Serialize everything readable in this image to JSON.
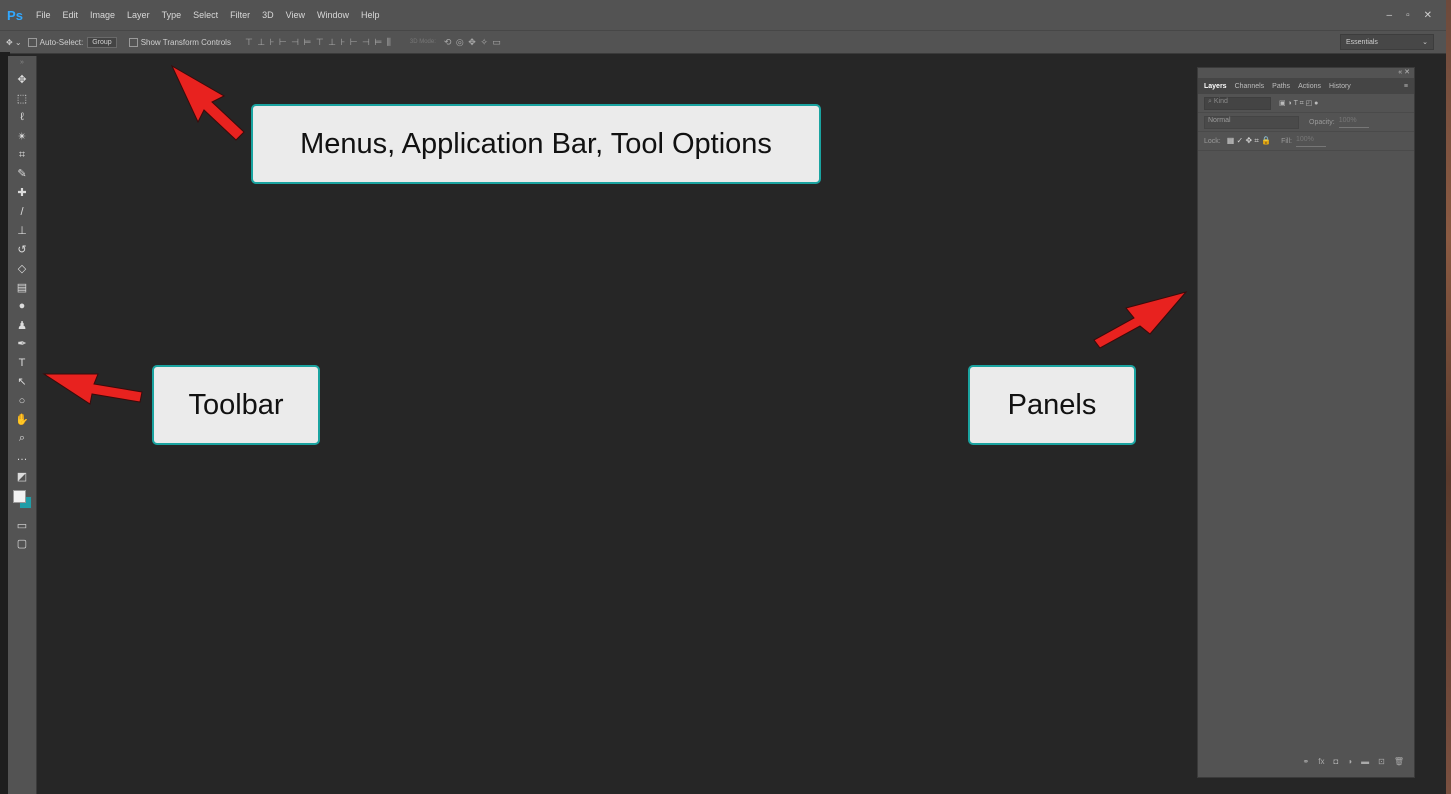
{
  "app": {
    "logo": "Ps",
    "menus": [
      "File",
      "Edit",
      "Image",
      "Layer",
      "Type",
      "Select",
      "Filter",
      "3D",
      "View",
      "Window",
      "Help"
    ],
    "window_controls": [
      "–",
      "▫",
      "✕"
    ]
  },
  "options_bar": {
    "auto_select_label": "Auto-Select:",
    "auto_select_value": "Group",
    "show_transform_label": "Show Transform Controls",
    "align_icons": "⊤ ⊥ ⊦ ⊢ ⊣ ⊨ ⊤ ⊥ ⊦ ⊢ ⊣ ⊨ ⫼",
    "mode_3d_label": "3D Mode:",
    "mode_3d_icons": "⟲ ◎ ✥ ✧ ▭",
    "workspace": "Essentials",
    "workspace_chevron": "⌄"
  },
  "toolbar": {
    "grip": "»",
    "tools": [
      {
        "name": "move-tool",
        "glyph": "✥"
      },
      {
        "name": "marquee-tool",
        "glyph": "⬚"
      },
      {
        "name": "lasso-tool",
        "glyph": "ℓ"
      },
      {
        "name": "magic-wand-tool",
        "glyph": "✴"
      },
      {
        "name": "crop-tool",
        "glyph": "⌗"
      },
      {
        "name": "eyedropper-tool",
        "glyph": "✎"
      },
      {
        "name": "healing-brush-tool",
        "glyph": "✚"
      },
      {
        "name": "brush-tool",
        "glyph": "/"
      },
      {
        "name": "clone-stamp-tool",
        "glyph": "⊥"
      },
      {
        "name": "history-brush-tool",
        "glyph": "↺"
      },
      {
        "name": "eraser-tool",
        "glyph": "◇"
      },
      {
        "name": "gradient-tool",
        "glyph": "▤"
      },
      {
        "name": "blur-tool",
        "glyph": "●"
      },
      {
        "name": "dodge-tool",
        "glyph": "♟"
      },
      {
        "name": "pen-tool",
        "glyph": "✒"
      },
      {
        "name": "type-tool",
        "glyph": "T"
      },
      {
        "name": "path-selection-tool",
        "glyph": "↖"
      },
      {
        "name": "ellipse-tool",
        "glyph": "○"
      },
      {
        "name": "hand-tool",
        "glyph": "✋"
      },
      {
        "name": "zoom-tool",
        "glyph": "⌕"
      },
      {
        "name": "more-tools",
        "glyph": "…"
      },
      {
        "name": "default-colors",
        "glyph": "◩"
      }
    ],
    "quick_mask_glyph": "▭",
    "screen_mode_glyph": "▢",
    "foreground_color": "#f2f2f2",
    "background_color": "#1f9ea8"
  },
  "panel": {
    "top_controls": "« ✕",
    "tabs": [
      "Layers",
      "Channels",
      "Paths",
      "Actions",
      "History"
    ],
    "active_tab": "Layers",
    "menu_glyph": "≡",
    "kind_placeholder": "⌕ Kind",
    "filter_icons": "▣ ◑ T ⌗ ◰ ●",
    "blend_mode": "Normal",
    "opacity_label": "Opacity:",
    "opacity_value": "100%",
    "lock_label": "Lock:",
    "lock_icons": "▦ ✓ ✥ ⌗ 🔒",
    "fill_label": "Fill:",
    "fill_value": "100%",
    "footer_icons": [
      "⚭",
      "fx",
      "◘",
      "◑",
      "▬",
      "⊡",
      "🗑"
    ]
  },
  "callouts": {
    "menus": "Menus, Application Bar, Tool Options",
    "toolbar": "Toolbar",
    "panels": "Panels"
  },
  "colors": {
    "callout_border": "#1aa3a0",
    "arrow": "#e8221f",
    "canvas": "#262626",
    "chrome": "#535353"
  }
}
